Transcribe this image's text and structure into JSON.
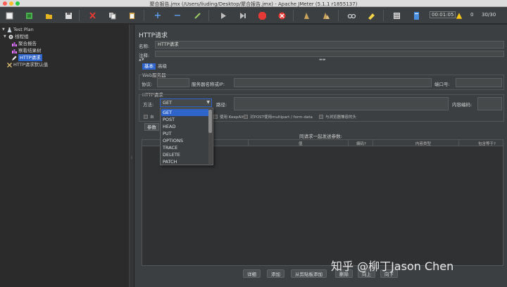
{
  "window": {
    "title": "聚合报告.jmx (/Users/liuding/Desktop/聚合报告.jmx) - Apache JMeter (5.1.1 r1855137)"
  },
  "toolbar": {
    "elapsed_time": "00:01:05",
    "error_count": "0",
    "threads": "30/30"
  },
  "tree": {
    "items": [
      {
        "label": "Test Plan"
      },
      {
        "label": "线程组"
      },
      {
        "label": "聚合报告"
      },
      {
        "label": "察看结果树"
      },
      {
        "label": "HTTP请求"
      },
      {
        "label": "HTTP请求默认值"
      }
    ]
  },
  "panel": {
    "title": "HTTP请求",
    "name_label": "名称:",
    "name_value": "HTTP请求",
    "comment_label": "注释:",
    "tabs": [
      "基本",
      "高级"
    ],
    "web_server_section": "Web服务器",
    "protocol_label": "协议:",
    "server_label": "服务器名称或IP:",
    "port_label": "端口号:",
    "http_request_section": "HTTP请求",
    "method_label": "方法:",
    "method_value": "GET",
    "path_label": "路径:",
    "encoding_label": "内容编码:",
    "options": [
      "自",
      "使用 KeepAlive",
      "对POST使用multipart / form-data",
      "与浏览器兼容的头"
    ],
    "params_tab": "参数",
    "params_title": "同请求一起发送参数:",
    "columns": [
      "",
      "值",
      "编码?",
      "内容类型",
      "包含等于?"
    ],
    "buttons": [
      "详细",
      "添加",
      "从剪贴板添加",
      "删除",
      "向上",
      "向下"
    ]
  },
  "method_dropdown": {
    "options": [
      "GET",
      "POST",
      "HEAD",
      "PUT",
      "OPTIONS",
      "TRACE",
      "DELETE",
      "PATCH"
    ],
    "selected": "GET"
  },
  "watermark": "知乎 @柳丁Jason Chen",
  "colors": {
    "selection": "#2f65ca",
    "panel": "#3c3f41",
    "tree_bg": "#2b2b2b"
  }
}
